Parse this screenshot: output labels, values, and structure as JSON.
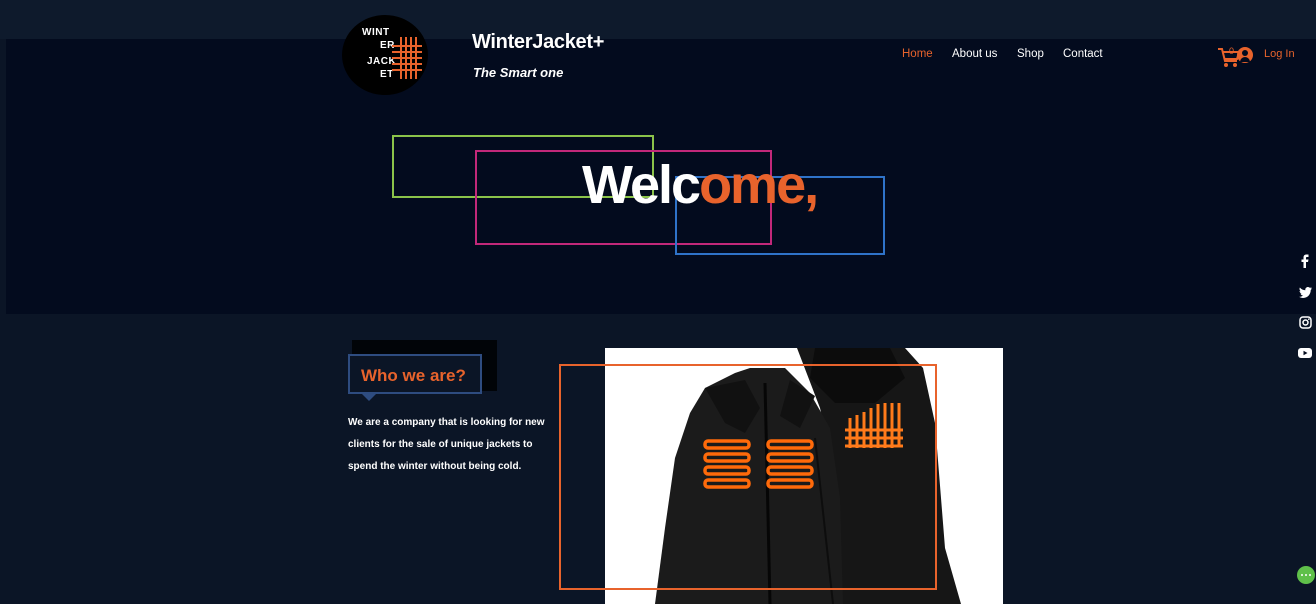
{
  "brand": {
    "logo_lines": [
      "WINT",
      "ER",
      "JACK",
      "ET"
    ],
    "title": "WinterJacket+",
    "tagline": "The Smart one"
  },
  "nav": {
    "items": [
      {
        "label": "Home",
        "active": true
      },
      {
        "label": "About us",
        "active": false
      },
      {
        "label": "Shop",
        "active": false
      },
      {
        "label": "Contact",
        "active": false
      }
    ]
  },
  "cart": {
    "count": "0",
    "icon": "cart-icon"
  },
  "login": {
    "label": "Log In",
    "icon": "user-avatar-icon"
  },
  "hero": {
    "welcome_white": "Welc",
    "welcome_orange": "ome,"
  },
  "social": [
    "facebook-icon",
    "twitter-icon",
    "instagram-icon",
    "youtube-icon"
  ],
  "about": {
    "heading": "Who we are?",
    "body": "We are a company that is looking for new clients for the sale of unique jackets to spend the winter without being cold."
  },
  "colors": {
    "accent": "#e8632c",
    "hero_bg": "#030b1e",
    "page_bg": "#0b1526",
    "frame_green": "#8bc34a",
    "frame_pink": "#c2287a",
    "frame_blue": "#2f73c9"
  }
}
